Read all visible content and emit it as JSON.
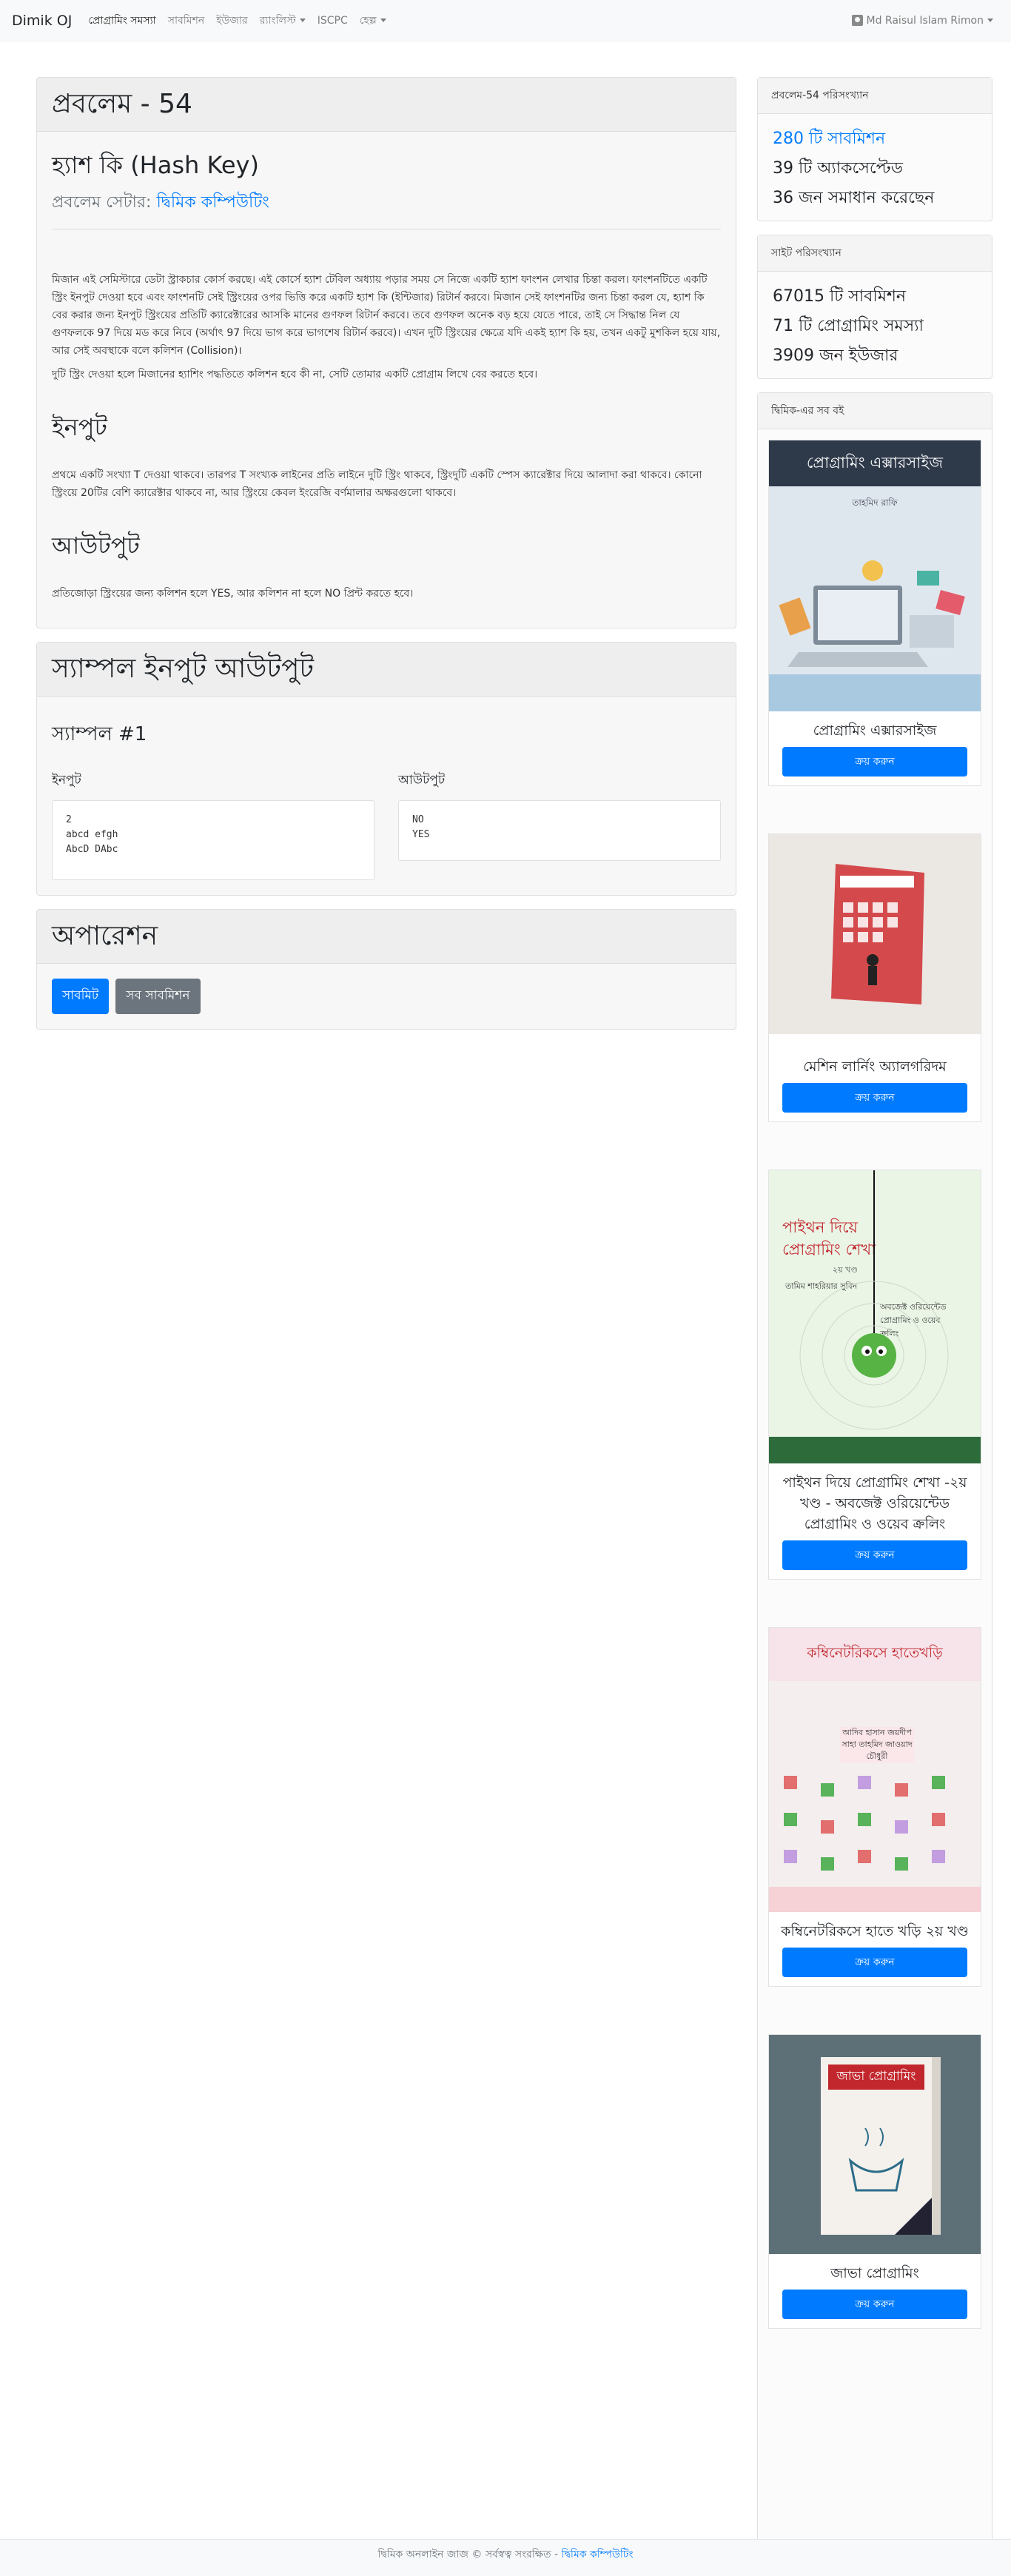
{
  "nav": {
    "brand": "Dimik OJ",
    "items": [
      "প্রোগ্রামিং সমস্যা",
      "সাবমিশন",
      "ইউজার",
      "র‍্যাংলিস্ট",
      "ISCPC",
      "হেল্প"
    ],
    "user": "Md Raisul Islam Rimon"
  },
  "problem": {
    "header": "প্রবলেম - 54",
    "title": "হ্যাশ কি (Hash Key)",
    "setter_label": "প্রবলেম সেটার:",
    "setter_name": "দ্বিমিক কম্পিউটিং",
    "statement_1": "মিজান এই সেমিস্টারে ডেটা স্ট্রাকচার কোর্স করছে। এই কোর্সে হ্যাশ টেবিল অধ্যায় পড়ার সময় সে নিজে একটি হ্যাশ ফাংশন লেখার চিন্তা করল। ফাংশনটিতে একটি স্ট্রিং ইনপুট দেওয়া হবে এবং ফাংশনটি সেই স্ট্রিংয়ের ওপর ভিত্তি করে একটি হ্যাশ কি (ইন্টিজার) রিটার্ন করবে। মিজান সেই ফাংশনটির জন্য চিন্তা করল যে, হ্যাশ কি বের করার জন্য ইনপুট স্ট্রিংয়ের প্রতিটি ক্যারেক্টারের আসকি মানের গুণফল রিটার্ন করবে। তবে গুণফল অনেক বড় হয়ে যেতে পারে, তাই সে সিদ্ধান্ত নিল যে গুণফলকে 97 দিয়ে মড করে নিবে (অর্থাৎ 97 দিয়ে ভাগ করে ভাগশেষ রিটার্ন করবে)। এখন দুটি স্ট্রিংয়ের ক্ষেত্রে যদি একই হ্যাশ কি হয়, তখন একটু মুশকিল হয়ে যায়, আর সেই অবস্থাকে বলে কলিশন (Collision)।",
    "statement_2": "দুটি স্ট্রিং দেওয়া হলে মিজানের হ্যাশিং পদ্ধতিতে কলিশন হবে কী না, সেটি তোমার একটি প্রোগ্রাম লিখে বের করতে হবে।",
    "input_heading": "ইনপুট",
    "input_text": "প্রথমে একটি সংখ্যা T দেওয়া থাকবে। তারপর T সংখ্যক লাইনের প্রতি লাইনে দুটি স্ট্রিং থাকবে, স্ট্রিংদুটি একটি স্পেস ক্যারেক্টার দিয়ে আলাদা করা থাকবে। কোনো স্ট্রিংয়ে 20টির বেশি ক্যারেক্টার থাকবে না, আর স্ট্রিংয়ে কেবল ইংরেজি বর্ণমালার অক্ষরগুলো থাকবে।",
    "output_heading": "আউটপুট",
    "output_text": "প্রতিজোড়া স্ট্রিংয়ের জন্য কলিশন হলে YES, আর কলিশন না হলে NO প্রিন্ট করতে হবে।"
  },
  "samples": {
    "header": "স্যাম্পল ইনপুট আউটপুট",
    "sample_title": "স্যাম্পল #1",
    "input_label": "ইনপুট",
    "output_label": "আউটপুট",
    "input_lines": [
      "2",
      "abcd efgh",
      "AbcD DAbc"
    ],
    "output_lines": [
      "NO",
      "YES"
    ]
  },
  "operations": {
    "header": "অপারেশন",
    "submit": "সাবমিট",
    "all_submissions": "সব সাবমিশন"
  },
  "problem_stats": {
    "header": "প্রবলেম-54 পরিসংখ্যান",
    "submissions": "280 টি সাবমিশন",
    "accepted": "39 টি অ্যাকসেপ্টেড",
    "solved": "36 জন সমাধান করেছেন"
  },
  "site_stats": {
    "header": "সাইট পরিসংখ্যান",
    "submissions": "67015 টি সাবমিশন",
    "problems": "71 টি প্রোগ্রামিং সমস্যা",
    "users": "3909 জন ইউজার"
  },
  "books": {
    "header": "দ্বিমিক-এর সব বই",
    "buy_label": "ক্রয় করুন",
    "items": [
      {
        "title": "প্রোগ্রামিং এক্সারসাইজ",
        "cover_title": "প্রোগ্রামিং এক্সারসাইজ",
        "cover_author": "তাহমিদ রাফি"
      },
      {
        "title": "মেশিন লার্নিং অ্যালগরিদম",
        "cover_title": "মেশিন লার্নিং অ্যালগরিদম"
      },
      {
        "title": "পাইথন দিয়ে প্রোগ্রামিং শেখা -২য় খণ্ড - অবজেক্ট ওরিয়েন্টেড প্রোগ্রামিং ও ওয়েব ক্রলিং",
        "cover_title": "পাইথন দিয়ে",
        "cover_title2": "প্রোগ্রামিং শেখা",
        "cover_part": "২য় খণ্ড",
        "cover_author": "তামিম শাহরিয়ার সুবিন",
        "cover_sub": "অবজেক্ট ওরিয়েন্টেড প্রোগ্রামিং ও ওয়েব ক্রলিং"
      },
      {
        "title": "কম্বিনেটরিকসে হাতে খড়ি ২য় খণ্ড",
        "cover_title": "কম্বিনেটরিকসে হাতেখড়ি",
        "cover_author": "আদিব হাসান জয়দীপ সাহা তাহমিদ জাওয়াদ চৌধুরী"
      },
      {
        "title": "জাভা প্রোগ্রামিং",
        "cover_title": "জাভা প্রোগ্রামিং"
      }
    ]
  },
  "footer": {
    "text": "দ্বিমিক অনলাইন জাজ © সর্বস্বত্ব সংরক্ষিত -",
    "link": "দ্বিমিক কম্পিউটিং"
  }
}
